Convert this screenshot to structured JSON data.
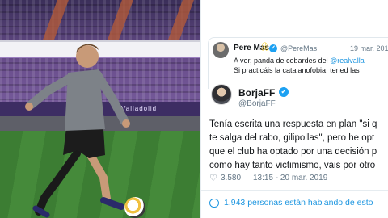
{
  "photo": {
    "ad_text": "Valladolid"
  },
  "quoted_tweet": {
    "name": "Pere Mas",
    "ribbon_icon": "yellow-ribbon-icon",
    "handle": "@PereMas",
    "date": "19 mar. 2019",
    "line1_prefix": "A ver, panda de cobardes del",
    "line1_mention": "@realvalla",
    "line2": "Si practicáis la catalanofobia, tened las"
  },
  "main_tweet": {
    "name": "BorjaFF",
    "handle": "@BorjaFF",
    "lines": [
      "Tenía escrita una respuesta en plan \"si q",
      "te salga del rabo, gilipollas\", pero he opt",
      "que el club ha optado por una decisión p",
      "como hay tanto victimismo, vais por otro"
    ],
    "likes": "3.580",
    "timestamp": "13:15 - 20 mar. 2019",
    "talking": "1.943 personas están hablando de esto"
  },
  "colors": {
    "link": "#1b95e0",
    "verified": "#1da1f2",
    "muted": "#657786"
  }
}
